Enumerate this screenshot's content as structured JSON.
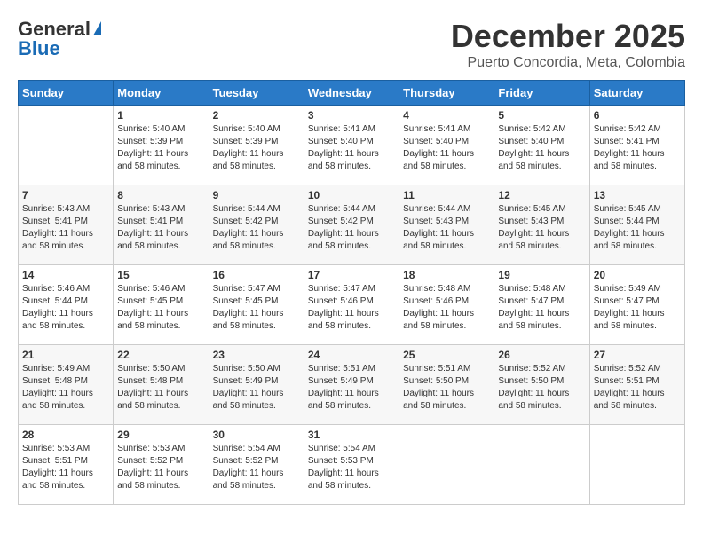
{
  "header": {
    "logo_general": "General",
    "logo_blue": "Blue",
    "month_title": "December 2025",
    "location": "Puerto Concordia, Meta, Colombia"
  },
  "days_of_week": [
    "Sunday",
    "Monday",
    "Tuesday",
    "Wednesday",
    "Thursday",
    "Friday",
    "Saturday"
  ],
  "weeks": [
    [
      {
        "day": "",
        "sunrise": "",
        "sunset": "",
        "daylight": ""
      },
      {
        "day": "1",
        "sunrise": "Sunrise: 5:40 AM",
        "sunset": "Sunset: 5:39 PM",
        "daylight": "Daylight: 11 hours and 58 minutes."
      },
      {
        "day": "2",
        "sunrise": "Sunrise: 5:40 AM",
        "sunset": "Sunset: 5:39 PM",
        "daylight": "Daylight: 11 hours and 58 minutes."
      },
      {
        "day": "3",
        "sunrise": "Sunrise: 5:41 AM",
        "sunset": "Sunset: 5:40 PM",
        "daylight": "Daylight: 11 hours and 58 minutes."
      },
      {
        "day": "4",
        "sunrise": "Sunrise: 5:41 AM",
        "sunset": "Sunset: 5:40 PM",
        "daylight": "Daylight: 11 hours and 58 minutes."
      },
      {
        "day": "5",
        "sunrise": "Sunrise: 5:42 AM",
        "sunset": "Sunset: 5:40 PM",
        "daylight": "Daylight: 11 hours and 58 minutes."
      },
      {
        "day": "6",
        "sunrise": "Sunrise: 5:42 AM",
        "sunset": "Sunset: 5:41 PM",
        "daylight": "Daylight: 11 hours and 58 minutes."
      }
    ],
    [
      {
        "day": "7",
        "sunrise": "Sunrise: 5:43 AM",
        "sunset": "Sunset: 5:41 PM",
        "daylight": "Daylight: 11 hours and 58 minutes."
      },
      {
        "day": "8",
        "sunrise": "Sunrise: 5:43 AM",
        "sunset": "Sunset: 5:41 PM",
        "daylight": "Daylight: 11 hours and 58 minutes."
      },
      {
        "day": "9",
        "sunrise": "Sunrise: 5:44 AM",
        "sunset": "Sunset: 5:42 PM",
        "daylight": "Daylight: 11 hours and 58 minutes."
      },
      {
        "day": "10",
        "sunrise": "Sunrise: 5:44 AM",
        "sunset": "Sunset: 5:42 PM",
        "daylight": "Daylight: 11 hours and 58 minutes."
      },
      {
        "day": "11",
        "sunrise": "Sunrise: 5:44 AM",
        "sunset": "Sunset: 5:43 PM",
        "daylight": "Daylight: 11 hours and 58 minutes."
      },
      {
        "day": "12",
        "sunrise": "Sunrise: 5:45 AM",
        "sunset": "Sunset: 5:43 PM",
        "daylight": "Daylight: 11 hours and 58 minutes."
      },
      {
        "day": "13",
        "sunrise": "Sunrise: 5:45 AM",
        "sunset": "Sunset: 5:44 PM",
        "daylight": "Daylight: 11 hours and 58 minutes."
      }
    ],
    [
      {
        "day": "14",
        "sunrise": "Sunrise: 5:46 AM",
        "sunset": "Sunset: 5:44 PM",
        "daylight": "Daylight: 11 hours and 58 minutes."
      },
      {
        "day": "15",
        "sunrise": "Sunrise: 5:46 AM",
        "sunset": "Sunset: 5:45 PM",
        "daylight": "Daylight: 11 hours and 58 minutes."
      },
      {
        "day": "16",
        "sunrise": "Sunrise: 5:47 AM",
        "sunset": "Sunset: 5:45 PM",
        "daylight": "Daylight: 11 hours and 58 minutes."
      },
      {
        "day": "17",
        "sunrise": "Sunrise: 5:47 AM",
        "sunset": "Sunset: 5:46 PM",
        "daylight": "Daylight: 11 hours and 58 minutes."
      },
      {
        "day": "18",
        "sunrise": "Sunrise: 5:48 AM",
        "sunset": "Sunset: 5:46 PM",
        "daylight": "Daylight: 11 hours and 58 minutes."
      },
      {
        "day": "19",
        "sunrise": "Sunrise: 5:48 AM",
        "sunset": "Sunset: 5:47 PM",
        "daylight": "Daylight: 11 hours and 58 minutes."
      },
      {
        "day": "20",
        "sunrise": "Sunrise: 5:49 AM",
        "sunset": "Sunset: 5:47 PM",
        "daylight": "Daylight: 11 hours and 58 minutes."
      }
    ],
    [
      {
        "day": "21",
        "sunrise": "Sunrise: 5:49 AM",
        "sunset": "Sunset: 5:48 PM",
        "daylight": "Daylight: 11 hours and 58 minutes."
      },
      {
        "day": "22",
        "sunrise": "Sunrise: 5:50 AM",
        "sunset": "Sunset: 5:48 PM",
        "daylight": "Daylight: 11 hours and 58 minutes."
      },
      {
        "day": "23",
        "sunrise": "Sunrise: 5:50 AM",
        "sunset": "Sunset: 5:49 PM",
        "daylight": "Daylight: 11 hours and 58 minutes."
      },
      {
        "day": "24",
        "sunrise": "Sunrise: 5:51 AM",
        "sunset": "Sunset: 5:49 PM",
        "daylight": "Daylight: 11 hours and 58 minutes."
      },
      {
        "day": "25",
        "sunrise": "Sunrise: 5:51 AM",
        "sunset": "Sunset: 5:50 PM",
        "daylight": "Daylight: 11 hours and 58 minutes."
      },
      {
        "day": "26",
        "sunrise": "Sunrise: 5:52 AM",
        "sunset": "Sunset: 5:50 PM",
        "daylight": "Daylight: 11 hours and 58 minutes."
      },
      {
        "day": "27",
        "sunrise": "Sunrise: 5:52 AM",
        "sunset": "Sunset: 5:51 PM",
        "daylight": "Daylight: 11 hours and 58 minutes."
      }
    ],
    [
      {
        "day": "28",
        "sunrise": "Sunrise: 5:53 AM",
        "sunset": "Sunset: 5:51 PM",
        "daylight": "Daylight: 11 hours and 58 minutes."
      },
      {
        "day": "29",
        "sunrise": "Sunrise: 5:53 AM",
        "sunset": "Sunset: 5:52 PM",
        "daylight": "Daylight: 11 hours and 58 minutes."
      },
      {
        "day": "30",
        "sunrise": "Sunrise: 5:54 AM",
        "sunset": "Sunset: 5:52 PM",
        "daylight": "Daylight: 11 hours and 58 minutes."
      },
      {
        "day": "31",
        "sunrise": "Sunrise: 5:54 AM",
        "sunset": "Sunset: 5:53 PM",
        "daylight": "Daylight: 11 hours and 58 minutes."
      },
      {
        "day": "",
        "sunrise": "",
        "sunset": "",
        "daylight": ""
      },
      {
        "day": "",
        "sunrise": "",
        "sunset": "",
        "daylight": ""
      },
      {
        "day": "",
        "sunrise": "",
        "sunset": "",
        "daylight": ""
      }
    ]
  ]
}
